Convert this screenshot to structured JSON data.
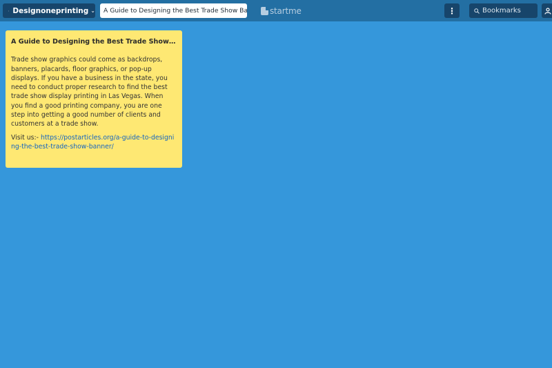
{
  "header": {
    "user_label": "Designoneprinting",
    "page_tab_label": "A Guide to Designing the Best Trade Show Banner",
    "brand_name": "startme",
    "search_placeholder": "Bookmarks"
  },
  "note": {
    "title": "A Guide to Designing the Best Trade Show Ba...",
    "body": "Trade show graphics could come as backdrops, banners, placards, floor graphics, or pop-up displays. If you have a business in the state, you need to conduct proper research to find the best trade show display printing in Las Vegas. When you find a good printing company, you are one step into getting a good number of clients and customers at a trade show.",
    "visit_prefix": "Visit us:- ",
    "link_text": "https://postarticles.org/a-guide-to-designing-the-best-trade-show-banner/",
    "background_color": "#fee873"
  },
  "colors": {
    "background": "#3597db",
    "topbar": "#236fa3",
    "button_dark": "#17456b"
  },
  "icons": {
    "user": "user-icon",
    "chevron": "chevron-down-icon",
    "more": "more-vertical-icon",
    "search": "search-icon",
    "account": "account-icon"
  }
}
